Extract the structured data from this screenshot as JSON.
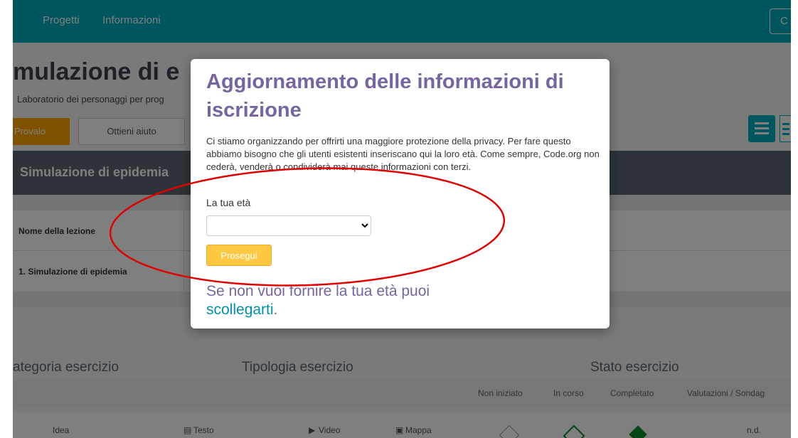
{
  "nav": {
    "projects": "Progetti",
    "info": "Informazioni",
    "corner_label": "C"
  },
  "lesson": {
    "title": "mulazione di e",
    "subtitle": "Laboratorio dei personaggi per prog",
    "try_button": "Provalo",
    "help_button": "Ottieni aiuto",
    "band_title": "Simulazione di epidemia",
    "table": {
      "header": "Nome della lezione",
      "row": "1. Simulazione di epidemia"
    }
  },
  "legend": {
    "category_title": "ategoria esercizio",
    "type_title": "Tipologia esercizio",
    "status_title": "Stato esercizio",
    "status_columns": [
      "Non iniziato",
      "In corso",
      "Completato",
      "Valutazioni / Sondag"
    ],
    "row": {
      "category": "Idea",
      "text": "Testo",
      "video": "Video",
      "map": "Mappa",
      "assessment": "n.d."
    },
    "colors": {
      "not_started": "#ffffff",
      "in_progress": "#ffffff",
      "completed": "#0e8f2c"
    }
  },
  "modal": {
    "title": "Aggiornamento delle informazioni di iscrizione",
    "body": "Ci stiamo organizzando per offrirti una maggiore protezione della privacy. Per fare questo abbiamo bisogno che gli utenti esistenti inseriscano qui la loro età. Come sempre, Code.org non cederà, venderà o condividerà mai queste informazioni con terzi.",
    "age_label": "La tua età",
    "age_selected": "",
    "continue_button": "Prosegui",
    "opt_out_text": "Se non vuoi fornire la tua età puoi",
    "opt_out_link": "scollegarti",
    "opt_out_suffix": "."
  },
  "colors": {
    "header_teal": "#00adbc",
    "modal_title": "#7665a0",
    "button_yellow": "#ffc842",
    "annotation_red": "#e00000"
  }
}
